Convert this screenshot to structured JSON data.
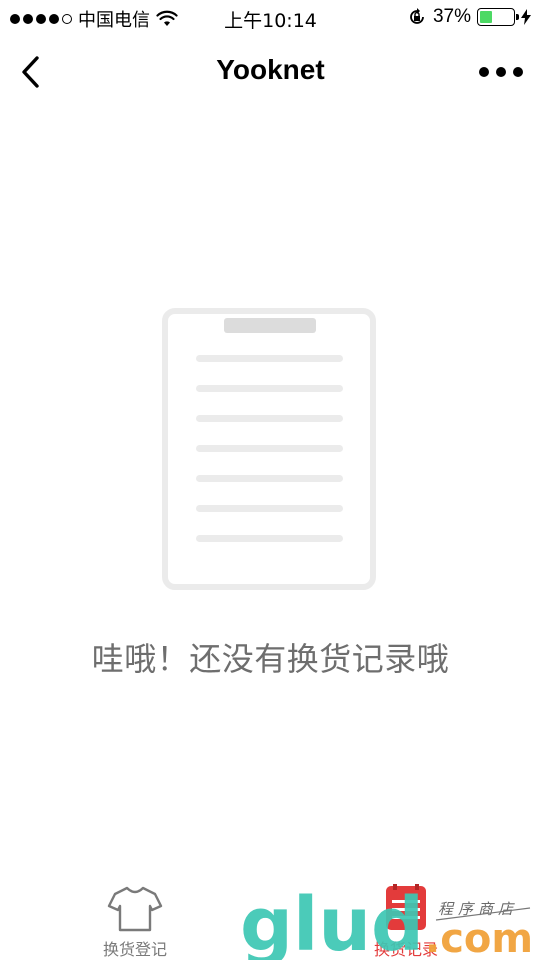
{
  "status_bar": {
    "carrier": "中国电信",
    "time": "上午10:14",
    "battery_percent_label": "37%",
    "battery_level": 0.37,
    "battery_color": "#4cd964"
  },
  "nav": {
    "title": "Yooknet",
    "back_icon": "chevron-left-icon",
    "more_icon": "more-horizontal-icon"
  },
  "empty_state": {
    "illustration_icon": "clipboard-document-icon",
    "message": "哇哦！还没有换货记录哦"
  },
  "tab_bar": {
    "tabs": [
      {
        "label": "换货登记",
        "icon": "tshirt-icon",
        "active": false
      },
      {
        "label": "换货记录",
        "icon": "record-list-icon",
        "active": true
      }
    ],
    "active_color": "#e33b3b",
    "inactive_color": "#7a7a7a"
  },
  "watermark": {
    "brand": "glud",
    "domain": ".com",
    "tagline": "程序商店"
  }
}
